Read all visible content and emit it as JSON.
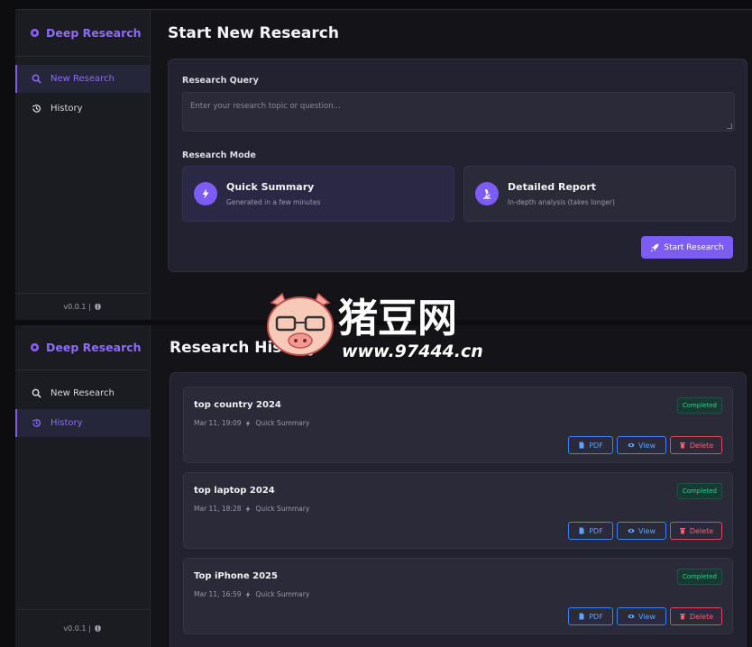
{
  "app": {
    "brand": "Deep Research",
    "version": "v0.0.1 |"
  },
  "nav": {
    "new_research": "New Research",
    "history": "History"
  },
  "new_research": {
    "title": "Start New Research",
    "query_label": "Research Query",
    "query_placeholder": "Enter your research topic or question...",
    "mode_label": "Research Mode",
    "modes": [
      {
        "title": "Quick Summary",
        "desc": "Generated in a few minutes",
        "icon": "bolt-icon",
        "selected": true
      },
      {
        "title": "Detailed Report",
        "desc": "In-depth analysis (takes longer)",
        "icon": "microscope-icon",
        "selected": false
      }
    ],
    "start_label": "Start Research"
  },
  "history": {
    "title": "Research History",
    "items": [
      {
        "title": "top country 2024",
        "time": "Mar 11, 19:09",
        "mode": "Quick Summary",
        "status": "Completed"
      },
      {
        "title": "top laptop 2024",
        "time": "Mar 11, 18:28",
        "mode": "Quick Summary",
        "status": "Completed"
      },
      {
        "title": "Top iPhone 2025",
        "time": "Mar 11, 16:59",
        "mode": "Quick Summary",
        "status": "Completed"
      }
    ],
    "actions": {
      "pdf": "PDF",
      "view": "View",
      "delete": "Delete"
    }
  },
  "watermark": {
    "text": "猪豆网",
    "url": "www.97444.cn"
  },
  "colors": {
    "accent": "#7c5cf5",
    "success": "#2ecf8f",
    "info": "#3b82f6",
    "danger": "#e0485f"
  }
}
